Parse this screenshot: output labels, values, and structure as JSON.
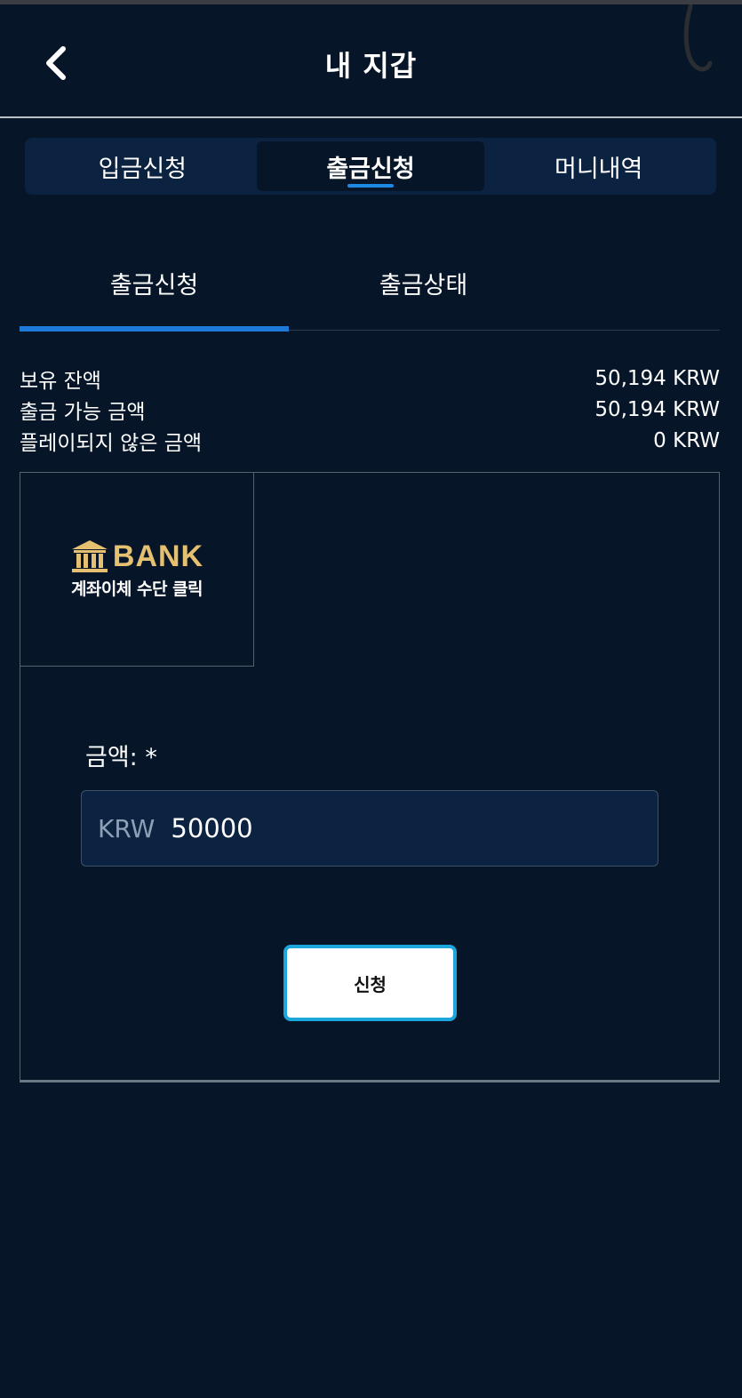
{
  "header": {
    "title": "내 지갑",
    "back_icon": "chevron-left-icon"
  },
  "main_tabs": [
    {
      "label": "입금신청",
      "active": false
    },
    {
      "label": "출금신청",
      "active": true
    },
    {
      "label": "머니내역",
      "active": false
    }
  ],
  "sub_tabs": [
    {
      "label": "출금신청",
      "active": true
    },
    {
      "label": "출금상태",
      "active": false
    }
  ],
  "balances": [
    {
      "label": "보유 잔액",
      "value": "50,194 KRW"
    },
    {
      "label": "출금 가능 금액",
      "value": "50,194 KRW"
    },
    {
      "label": "플레이되지 않은 금액",
      "value": "0 KRW"
    }
  ],
  "bank_option": {
    "logo_text": "BANK",
    "caption": "계좌이체 수단 클릭"
  },
  "form": {
    "amount_label": "금액: *",
    "currency": "KRW",
    "amount_value": "50000",
    "submit_label": "신청"
  },
  "colors": {
    "background": "#061628",
    "tab_bar": "#0b2340",
    "accent_blue": "#1e7ad8",
    "bank_gold": "#e4c070",
    "button_border": "#1ba6dc"
  }
}
